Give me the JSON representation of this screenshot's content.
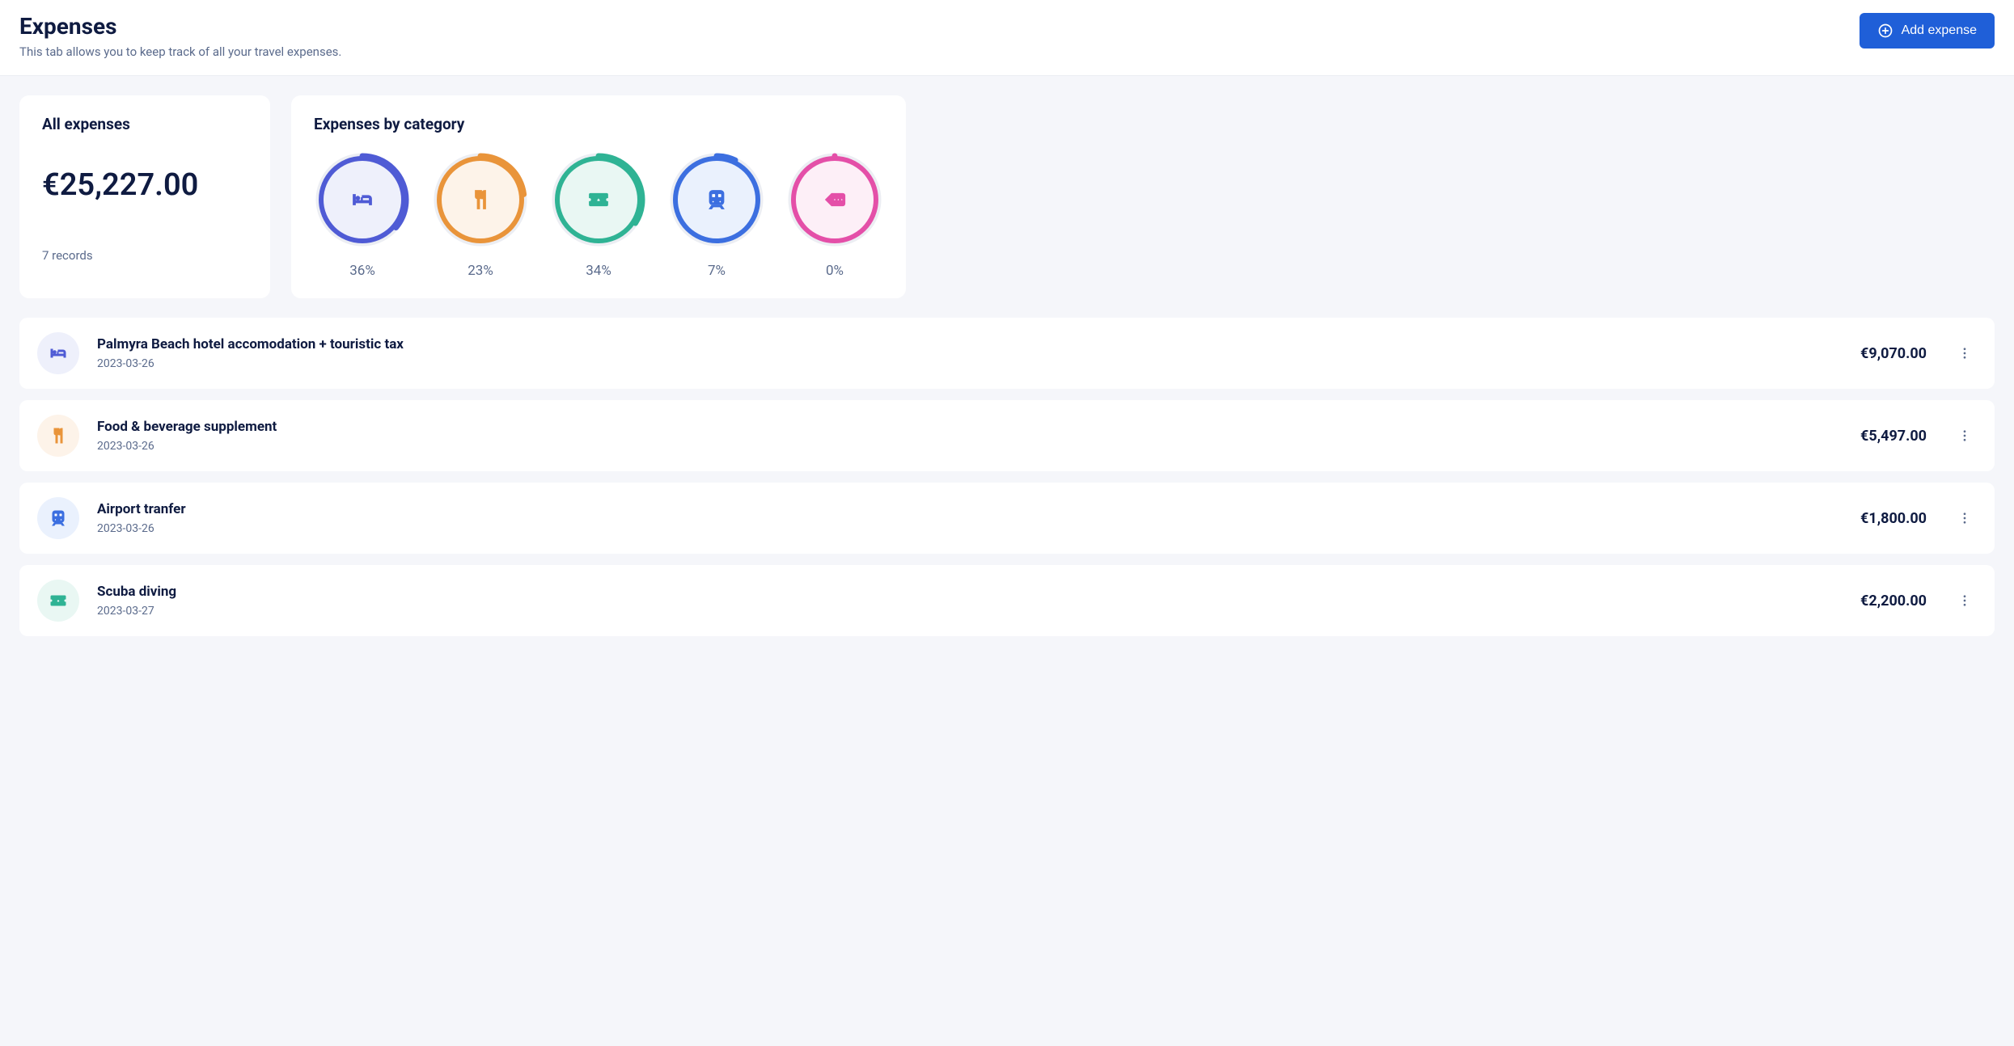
{
  "header": {
    "title": "Expenses",
    "subtitle": "This tab allows you to keep track of all your travel expenses.",
    "add_label": "Add expense"
  },
  "summary": {
    "all_title": "All expenses",
    "total": "€25,227.00",
    "records": "7 records",
    "by_cat_title": "Expenses by category"
  },
  "categories": [
    {
      "icon": "bed",
      "color": "indigo",
      "pct": 36,
      "label": "36%"
    },
    {
      "icon": "utensils",
      "color": "orange",
      "pct": 23,
      "label": "23%"
    },
    {
      "icon": "ticket",
      "color": "teal",
      "pct": 34,
      "label": "34%"
    },
    {
      "icon": "train",
      "color": "blue",
      "pct": 7,
      "label": "7%"
    },
    {
      "icon": "tag",
      "color": "pink",
      "pct": 0,
      "label": "0%"
    }
  ],
  "expenses": [
    {
      "icon": "bed",
      "color": "indigo",
      "title": "Palmyra Beach hotel accomodation + touristic tax",
      "date": "2023-03-26",
      "amount": "€9,070.00"
    },
    {
      "icon": "utensils",
      "color": "orange",
      "title": "Food & beverage supplement",
      "date": "2023-03-26",
      "amount": "€5,497.00"
    },
    {
      "icon": "train",
      "color": "blue",
      "title": "Airport tranfer",
      "date": "2023-03-26",
      "amount": "€1,800.00"
    },
    {
      "icon": "ticket",
      "color": "teal",
      "title": "Scuba diving",
      "date": "2023-03-27",
      "amount": "€2,200.00"
    }
  ]
}
